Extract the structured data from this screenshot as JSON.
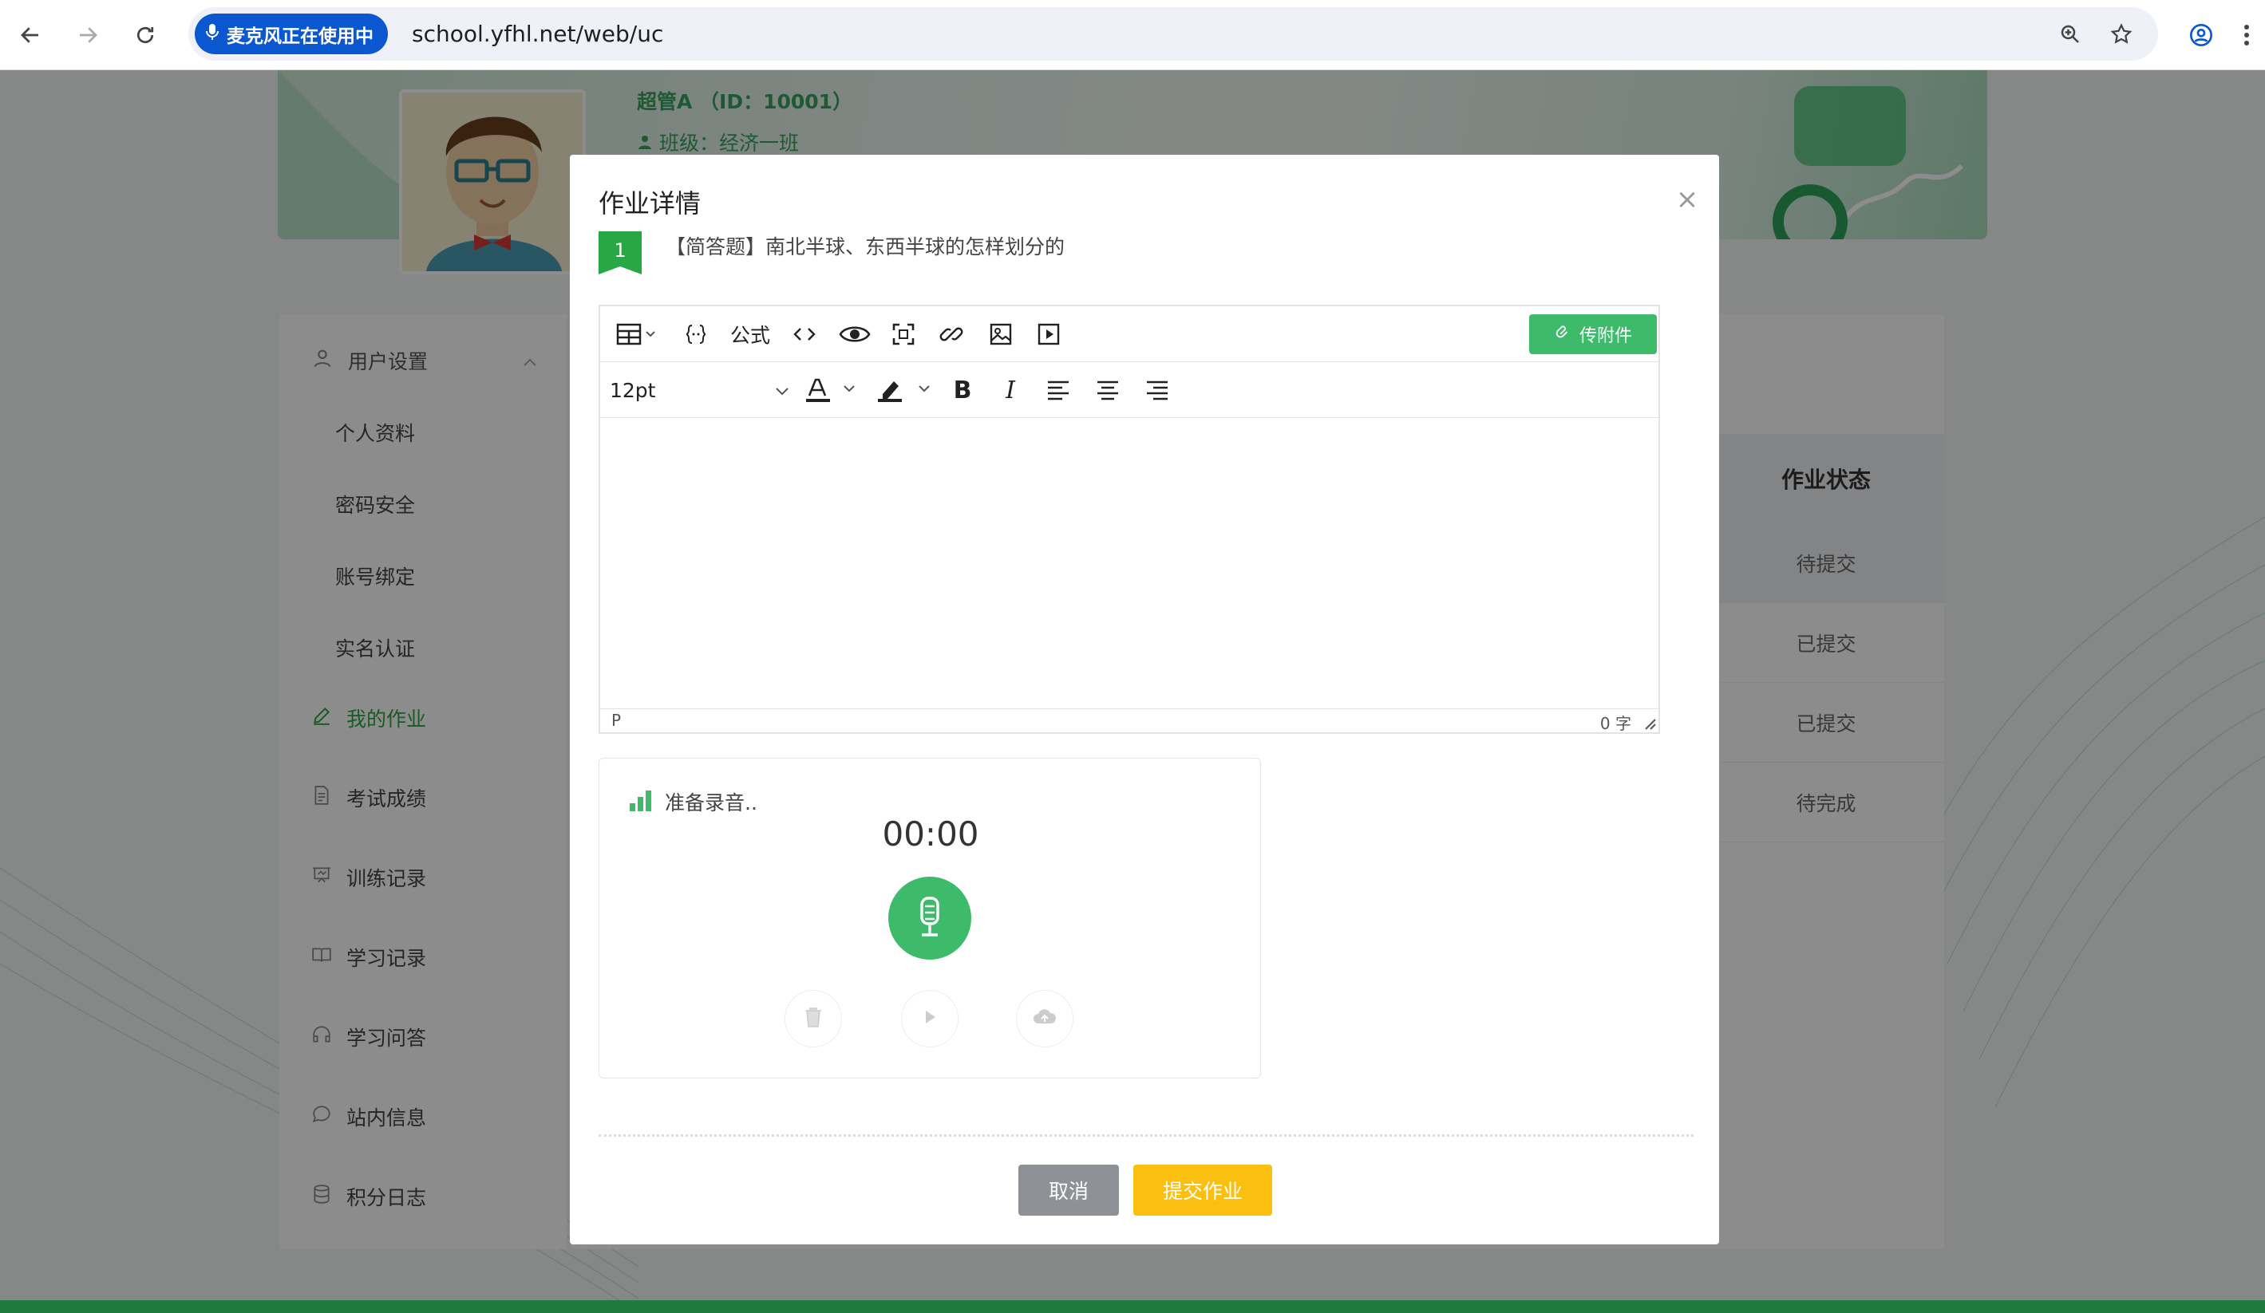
{
  "browser": {
    "mic_chip": "麦克风正在使用中",
    "url": "school.yfhl.net/web/uc"
  },
  "profile": {
    "name": "超管A （ID：10001）",
    "class": "班级：经济一班"
  },
  "sidebar": {
    "group_label": "用户设置",
    "sub_items": [
      {
        "label": "个人资料"
      },
      {
        "label": "密码安全"
      },
      {
        "label": "账号绑定"
      },
      {
        "label": "实名认证"
      }
    ],
    "items": [
      {
        "label": "我的作业",
        "icon": "edit-icon"
      },
      {
        "label": "考试成绩",
        "icon": "document-icon"
      },
      {
        "label": "训练记录",
        "icon": "presentation-icon"
      },
      {
        "label": "学习记录",
        "icon": "book-icon"
      },
      {
        "label": "学习问答",
        "icon": "headset-icon"
      },
      {
        "label": "站内信息",
        "icon": "chat-icon"
      },
      {
        "label": "积分日志",
        "icon": "database-icon"
      }
    ]
  },
  "table": {
    "status_header": "作业状态",
    "status_cells": [
      "待提交",
      "已提交",
      "已提交",
      "待完成"
    ]
  },
  "modal": {
    "title": "作业详情",
    "close": "×",
    "question_number": "1",
    "question_text": "【简答题】南北半球、东西半球的怎样划分的",
    "editor": {
      "formula_label": "公式",
      "attach_label": "传附件",
      "font_size": "12pt",
      "path": "P",
      "word_count": "0 字"
    },
    "recorder": {
      "status": "准备录音..",
      "time": "00:00"
    },
    "cancel": "取消",
    "submit": "提交作业"
  },
  "colors": {
    "accent": "#3dbb6a",
    "chrome_blue": "#0b57d0",
    "submit": "#fbbf10",
    "cancel": "#8e9196"
  }
}
